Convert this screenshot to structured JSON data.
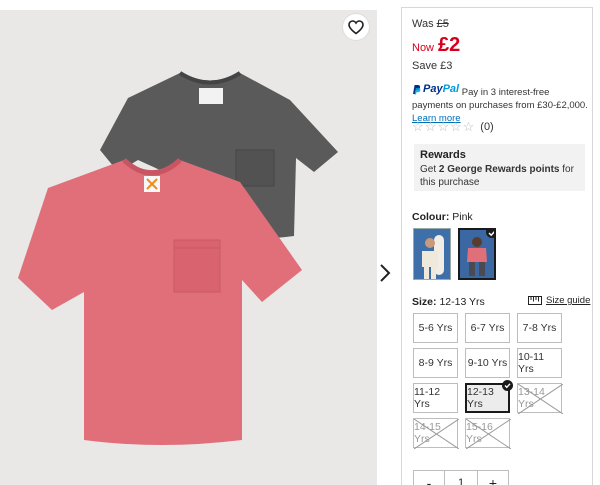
{
  "gallery": {
    "favourite_icon": "heart-outline-icon",
    "next_icon": "chevron-right-icon",
    "shirt_colors": {
      "back": "#5a5a5a",
      "front": "#e06f79"
    }
  },
  "price": {
    "was_label": "Was",
    "was_value": "£5",
    "now_label": "Now",
    "now_value": "£2",
    "save_label": "Save",
    "save_value": "£3",
    "accent_color": "#d6001c"
  },
  "paypal": {
    "logo_part1": "Pay",
    "logo_part2": "Pal",
    "text": "Pay in 3 interest-free payments on purchases from £30-£2,000.",
    "learn_more": "Learn more"
  },
  "rating": {
    "stars": 0,
    "max_stars": 5,
    "count": "(0)"
  },
  "rewards": {
    "title": "Rewards",
    "text_prefix": "Get ",
    "points": "2 George Rewards points",
    "text_suffix": " for this purchase"
  },
  "colour": {
    "label": "Colour:",
    "value": "Pink",
    "swatches": [
      {
        "name": "Beige",
        "selected": false
      },
      {
        "name": "Pink",
        "selected": true
      }
    ]
  },
  "size": {
    "label": "Size:",
    "value": "12-13 Yrs",
    "guide_label": "Size guide",
    "options": [
      {
        "label": "5-6 Yrs",
        "available": true,
        "selected": false
      },
      {
        "label": "6-7 Yrs",
        "available": true,
        "selected": false
      },
      {
        "label": "7-8 Yrs",
        "available": true,
        "selected": false
      },
      {
        "label": "8-9 Yrs",
        "available": true,
        "selected": false
      },
      {
        "label": "9-10 Yrs",
        "available": true,
        "selected": false
      },
      {
        "label": "10-11 Yrs",
        "available": true,
        "selected": false
      },
      {
        "label": "11-12 Yrs",
        "available": true,
        "selected": false
      },
      {
        "label": "12-13 Yrs",
        "available": true,
        "selected": true
      },
      {
        "label": "13-14 Yrs",
        "available": false,
        "selected": false
      },
      {
        "label": "14-15 Yrs",
        "available": false,
        "selected": false
      },
      {
        "label": "15-16 Yrs",
        "available": false,
        "selected": false
      }
    ]
  },
  "quantity": {
    "minus": "-",
    "value": "1",
    "plus": "+"
  }
}
